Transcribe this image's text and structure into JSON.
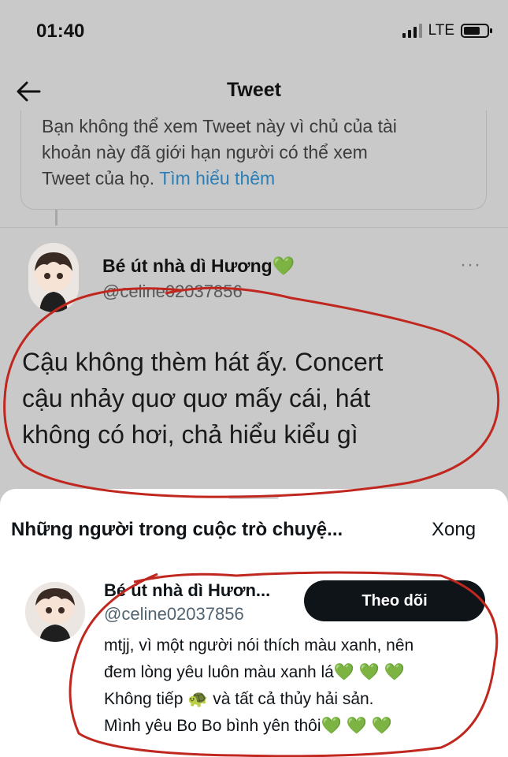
{
  "status_bar": {
    "time": "01:40",
    "network": "LTE"
  },
  "nav": {
    "title": "Tweet",
    "back_icon": "back-arrow-icon"
  },
  "notice": {
    "line1": "Bạn không thể xem Tweet này vì chủ của tài",
    "line2": "khoản này đã giới hạn người có thể xem",
    "line3_prefix": "Tweet của họ. ",
    "link": "Tìm hiểu thêm"
  },
  "tweet": {
    "name": "Bé út nhà dì Hương💚",
    "handle": "@celine02037856",
    "more": "···",
    "text_lines": [
      "Cậu không thèm hát ấy. Concert",
      "cậu nhảy quơ quơ mấy cái, hát",
      "không có hơi, chả hiểu kiểu gì"
    ]
  },
  "sheet": {
    "title": "Những người trong cuộc trò chuyệ...",
    "done_label": "Xong",
    "user": {
      "name": "Bé út nhà dì Hươn...",
      "handle": "@celine02037856",
      "follow_label": "Theo dõi",
      "bio_lines": [
        "mtjj, vì một người nói thích màu xanh, nên",
        "đem lòng yêu luôn màu xanh lá💚 💚 💚",
        "Không tiếp 🐢 và tất cả thủy hải sản.",
        "Mình yêu Bo Bo bình yên thôi💚 💚 💚"
      ]
    }
  },
  "colors": {
    "overlay": "#c9c9c9",
    "link": "#2a7fb8",
    "follow_bg": "#0f1419",
    "annotation": "#c0271f"
  }
}
